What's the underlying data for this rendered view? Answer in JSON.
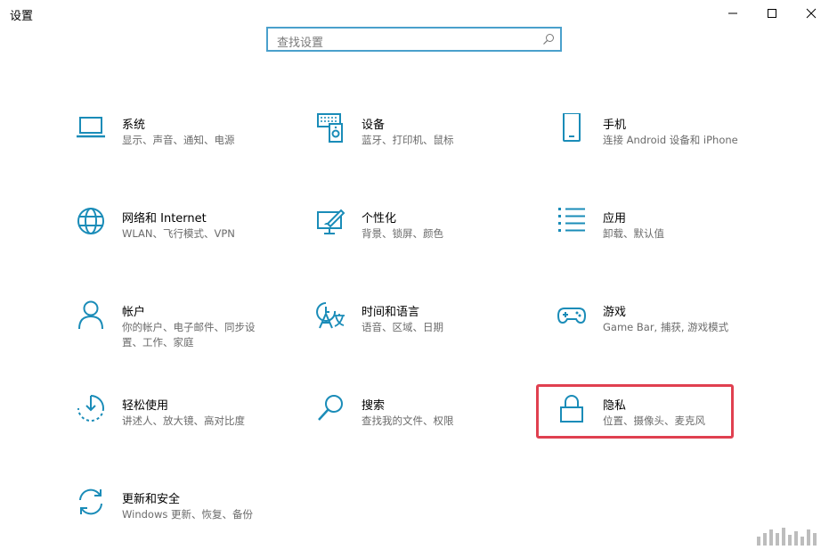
{
  "window": {
    "title": "设置"
  },
  "search": {
    "placeholder": "查找设置",
    "icon": "search-icon"
  },
  "accent": "#1a8cb8",
  "highlight_color": "#e04050",
  "tiles": [
    {
      "id": "system",
      "icon": "laptop-icon",
      "name": "系统",
      "desc": "显示、声音、通知、电源"
    },
    {
      "id": "devices",
      "icon": "devices-icon",
      "name": "设备",
      "desc": "蓝牙、打印机、鼠标"
    },
    {
      "id": "phone",
      "icon": "phone-icon",
      "name": "手机",
      "desc": "连接 Android 设备和 iPhone"
    },
    {
      "id": "network",
      "icon": "globe-icon",
      "name": "网络和 Internet",
      "desc": "WLAN、飞行模式、VPN"
    },
    {
      "id": "personalization",
      "icon": "personalization-icon",
      "name": "个性化",
      "desc": "背景、锁屏、颜色"
    },
    {
      "id": "apps",
      "icon": "apps-list-icon",
      "name": "应用",
      "desc": "卸载、默认值"
    },
    {
      "id": "accounts",
      "icon": "person-icon",
      "name": "帐户",
      "desc": "你的帐户、电子邮件、同步设置、工作、家庭"
    },
    {
      "id": "time-language",
      "icon": "time-language-icon",
      "name": "时间和语言",
      "desc": "语音、区域、日期"
    },
    {
      "id": "gaming",
      "icon": "gamepad-icon",
      "name": "游戏",
      "desc": "Game Bar, 捕获, 游戏模式"
    },
    {
      "id": "ease-of-access",
      "icon": "ease-of-access-icon",
      "name": "轻松使用",
      "desc": "讲述人、放大镜、高对比度"
    },
    {
      "id": "search",
      "icon": "magnifier-icon",
      "name": "搜索",
      "desc": "查找我的文件、权限"
    },
    {
      "id": "privacy",
      "icon": "lock-icon",
      "name": "隐私",
      "desc": "位置、摄像头、麦克风"
    },
    {
      "id": "update-security",
      "icon": "sync-icon",
      "name": "更新和安全",
      "desc": "Windows 更新、恢复、备份"
    }
  ]
}
